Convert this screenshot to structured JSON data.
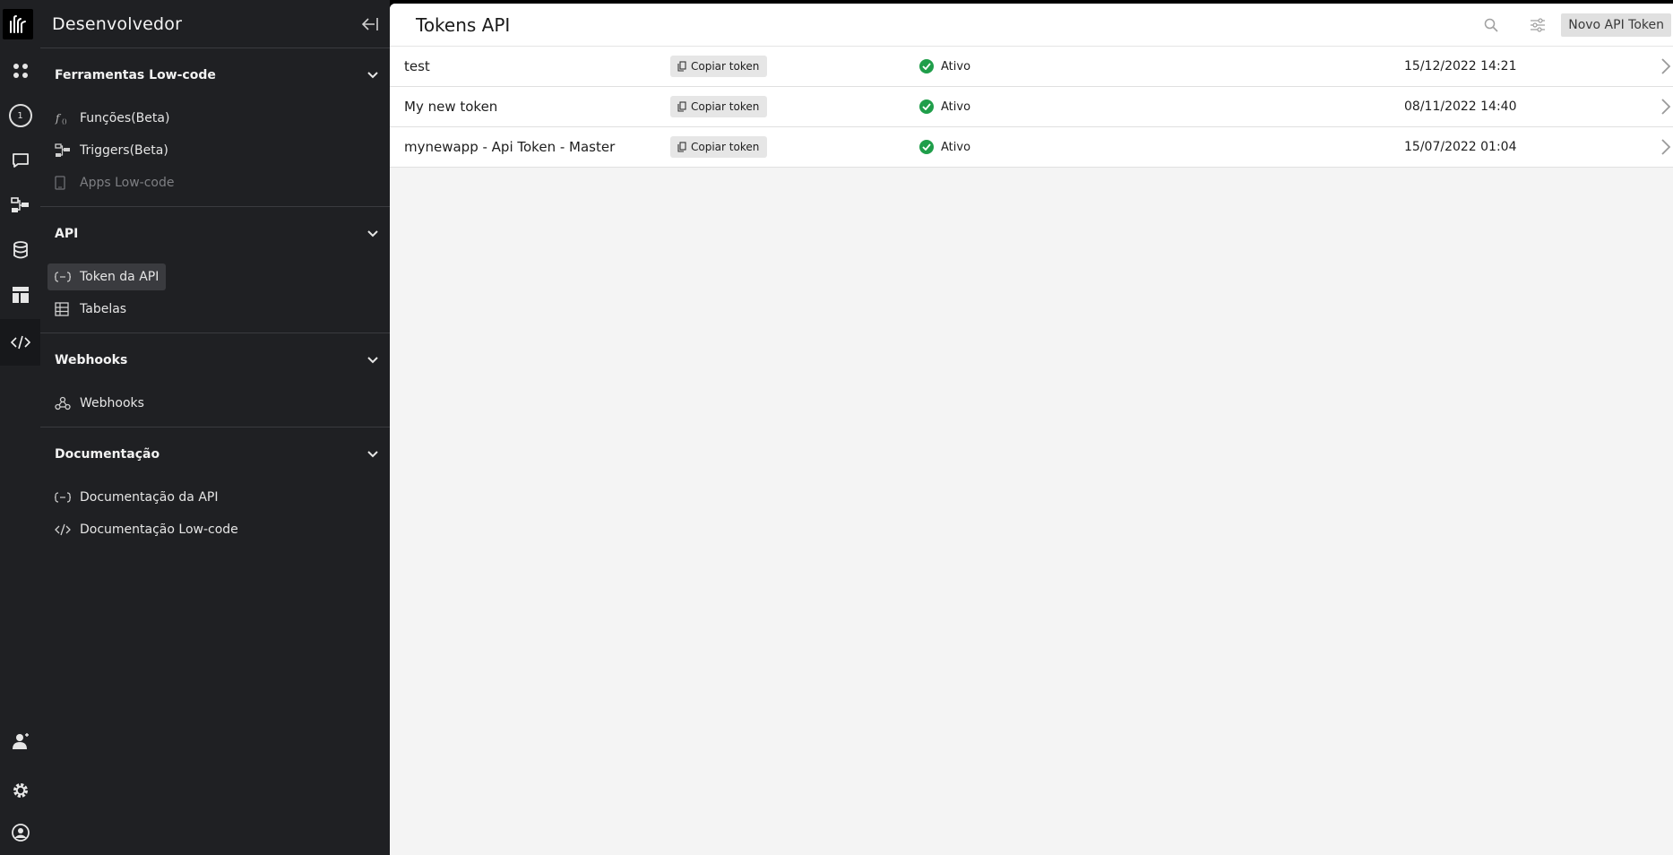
{
  "sidebar": {
    "title": "Desenvolvedor",
    "sections": [
      {
        "title": "Ferramentas Low-code",
        "items": [
          {
            "label": "Funções(Beta)",
            "icon": "function-icon"
          },
          {
            "label": "Triggers(Beta)",
            "icon": "trigger-icon"
          },
          {
            "label": "Apps Low-code",
            "icon": "app-icon",
            "disabled": true
          }
        ]
      },
      {
        "title": "API",
        "items": [
          {
            "label": "Token da API",
            "icon": "api-icon",
            "selected": true
          },
          {
            "label": "Tabelas",
            "icon": "table-icon"
          }
        ]
      },
      {
        "title": "Webhooks",
        "items": [
          {
            "label": "Webhooks",
            "icon": "webhook-icon"
          }
        ]
      },
      {
        "title": "Documentação",
        "items": [
          {
            "label": "Documentação da API",
            "icon": "api-icon"
          },
          {
            "label": "Documentação Low-code",
            "icon": "code-icon"
          }
        ]
      }
    ]
  },
  "rail": {
    "badge": "1"
  },
  "main": {
    "title": "Tokens API",
    "new_button": "Novo API Token",
    "copy_label": "Copiar token",
    "rows": [
      {
        "name": "test",
        "status": "Ativo",
        "date": "15/12/2022 14:21"
      },
      {
        "name": "My new token",
        "status": "Ativo",
        "date": "08/11/2022 14:40"
      },
      {
        "name": "mynewapp - Api Token - Master",
        "status": "Ativo",
        "date": "15/07/2022 01:04"
      }
    ]
  },
  "colors": {
    "status_active": "#1f9e4a",
    "sidebar_bg": "#1f2023",
    "main_bg": "#f4f4f4"
  }
}
